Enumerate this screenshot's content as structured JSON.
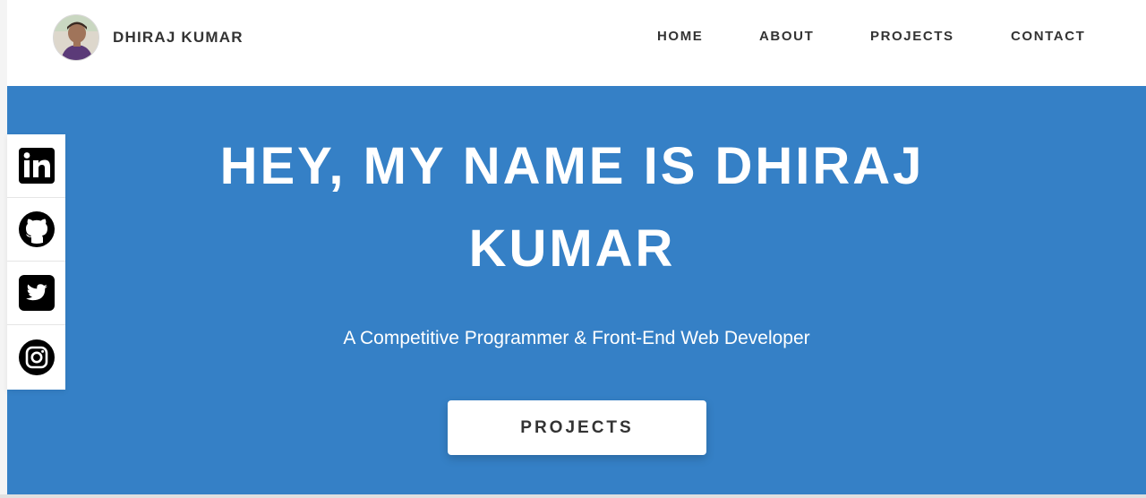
{
  "header": {
    "brand_name": "DHIRAJ KUMAR",
    "avatar_icon": "profile-photo",
    "nav": {
      "home": "HOME",
      "about": "ABOUT",
      "projects": "PROJECTS",
      "contact": "CONTACT"
    }
  },
  "hero": {
    "title": "HEY, MY NAME IS DHIRAJ KUMAR",
    "subtitle": "A Competitive Programmer & Front-End Web Developer",
    "button_label": "PROJECTS",
    "background_color": "#3580c6"
  },
  "social": {
    "items": [
      {
        "icon": "linkedin-icon"
      },
      {
        "icon": "github-icon"
      },
      {
        "icon": "twitter-icon"
      },
      {
        "icon": "instagram-icon"
      }
    ]
  }
}
